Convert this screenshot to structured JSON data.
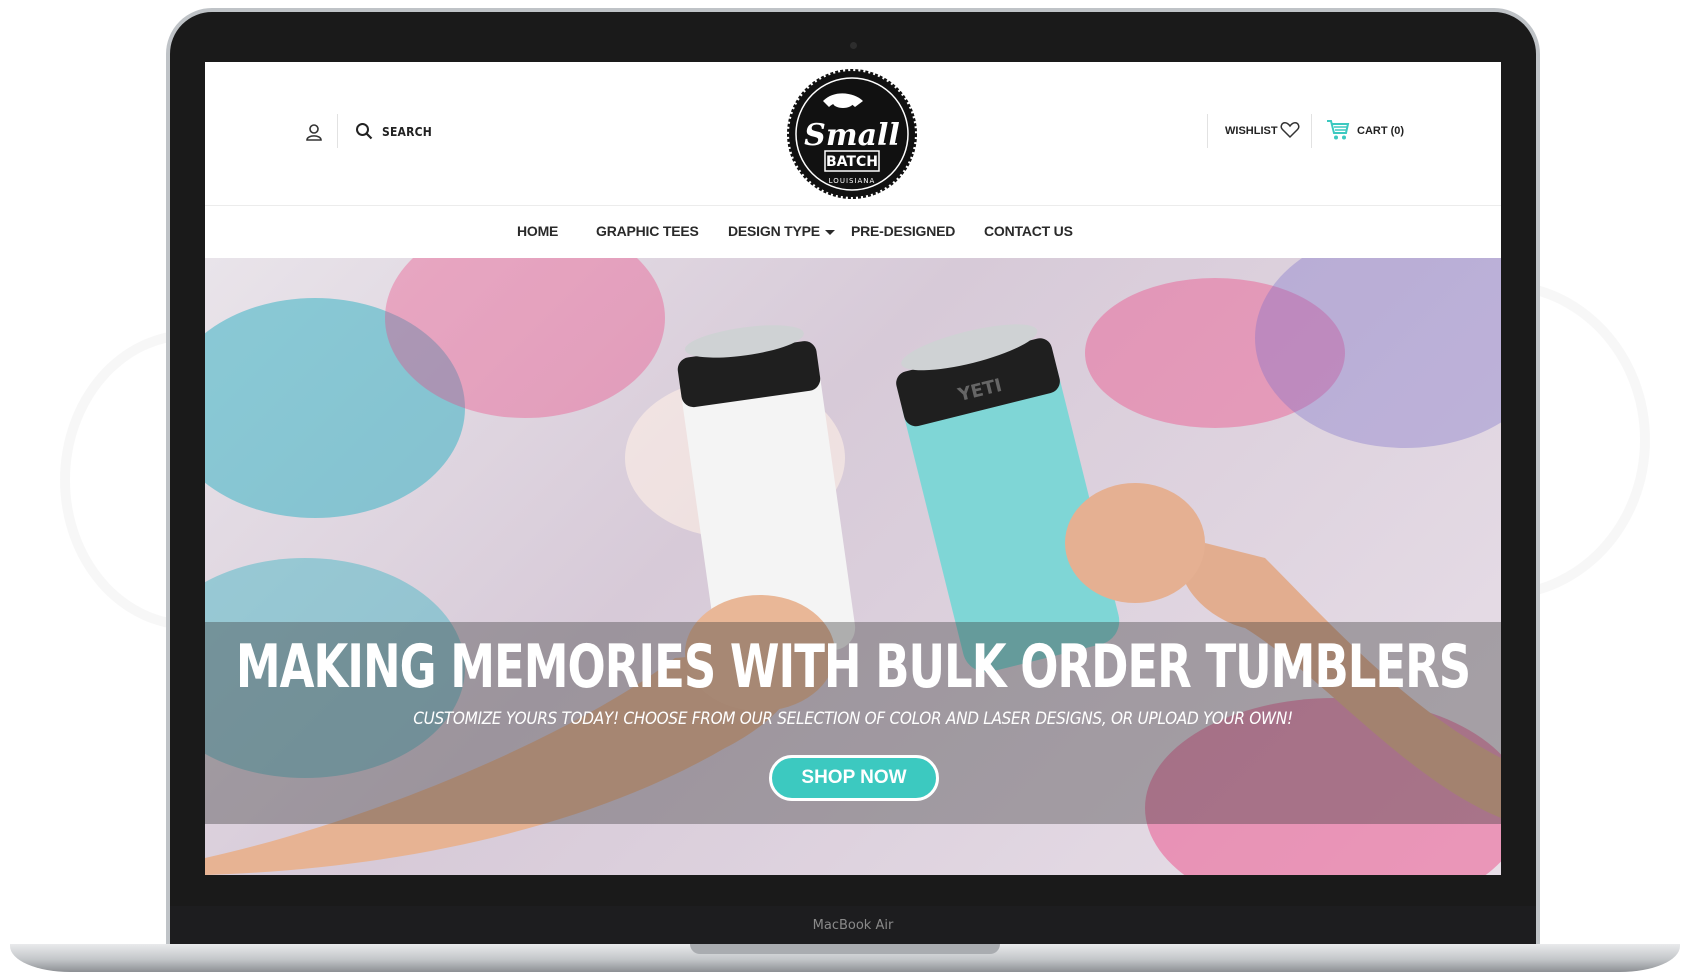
{
  "device": {
    "label": "MacBook Air"
  },
  "header": {
    "search_label": "SEARCH",
    "logo": {
      "line1": "Small",
      "line2": "BATCH",
      "line3": "LOUISIANA"
    },
    "wishlist_label": "WISHLIST",
    "cart_label": "CART (0)"
  },
  "nav": {
    "items": [
      {
        "label": "HOME"
      },
      {
        "label": "GRAPHIC TEES"
      },
      {
        "label": "DESIGN TYPE",
        "has_dropdown": true
      },
      {
        "label": "PRE-DESIGNED"
      },
      {
        "label": "CONTACT US"
      }
    ]
  },
  "hero": {
    "title": "MAKING MEMORIES WITH BULK ORDER TUMBLERS",
    "subtitle": "CUSTOMIZE YOURS TODAY! CHOOSE FROM OUR SELECTION OF COLOR AND LASER DESIGNS, OR UPLOAD YOUR OWN!",
    "cta_label": "SHOP NOW",
    "tumbler_brand": "YETI"
  },
  "colors": {
    "accent": "#3cc9c0",
    "cart_icon": "#3cc9c0",
    "text_dark": "#222222",
    "paint_pink": "#ee3f7e",
    "paint_teal": "#3db5c4"
  },
  "icons": [
    "user-icon",
    "search-icon",
    "heart-icon",
    "cart-icon",
    "chevron-down-icon"
  ]
}
